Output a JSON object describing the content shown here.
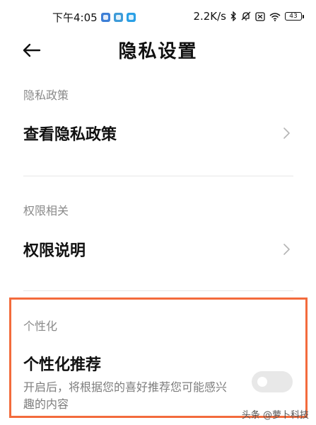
{
  "status_bar": {
    "time": "下午4:05",
    "network_speed": "2.2K/s",
    "battery": "43",
    "icons": [
      "app-notification-icon",
      "shield-notification-icon",
      "telegram-notification-icon",
      "bluetooth-icon",
      "mute-icon",
      "sim-icon",
      "wifi-icon",
      "battery-icon"
    ]
  },
  "header": {
    "title": "隐私设置",
    "back_icon": "arrow-left-icon"
  },
  "sections": [
    {
      "label": "隐私政策",
      "row": {
        "label": "查看隐私政策",
        "icon": "chevron-right-icon"
      }
    },
    {
      "label": "权限相关",
      "row": {
        "label": "权限说明",
        "icon": "chevron-right-icon"
      }
    },
    {
      "label": "个性化",
      "row": {
        "label": "个性化推荐",
        "description": "开启后，将根据您的喜好推荐您可能感兴趣的内容",
        "toggle_on": false
      }
    }
  ],
  "highlight_color": "#f36b3c",
  "watermark": "头条 @萝卜科技"
}
